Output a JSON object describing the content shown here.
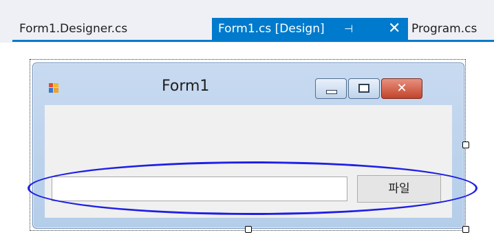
{
  "tabs": [
    {
      "label": "Form1.Designer.cs",
      "active": false
    },
    {
      "label": "Form1.cs [Design]",
      "active": true
    },
    {
      "label": "Program.cs",
      "active": false
    }
  ],
  "icons": {
    "pin": "pin-icon",
    "close": "close-icon"
  },
  "form": {
    "title": "Form1",
    "file_button_label": "파일",
    "textbox_value": ""
  },
  "colors": {
    "accent": "#007acc",
    "annotation": "#1f1fe6"
  }
}
